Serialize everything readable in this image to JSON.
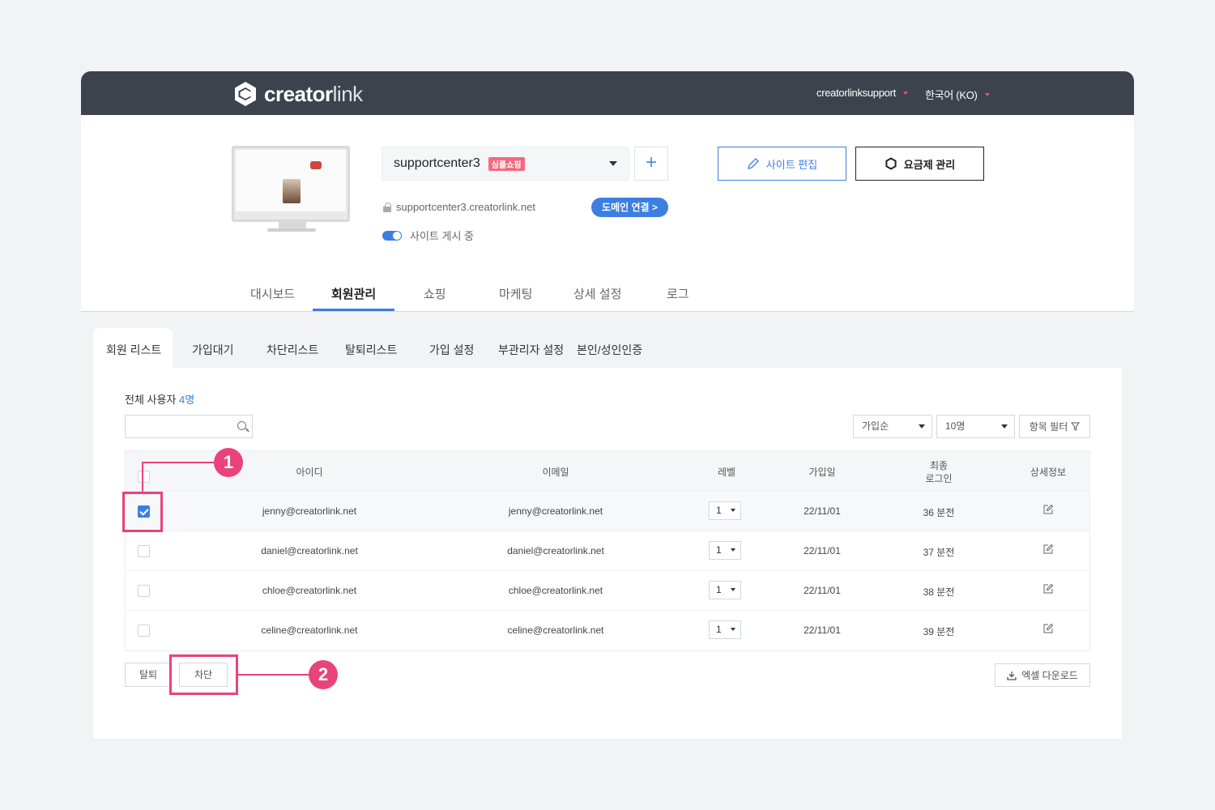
{
  "topbar": {
    "logo_bold": "creator",
    "logo_light": "link",
    "user": "creatorlinksupport",
    "language": "한국어 (KO)"
  },
  "site": {
    "name": "supportcenter3",
    "badge": "심플쇼핑",
    "add_label": "+",
    "url": "supportcenter3.creatorlink.net",
    "domain_button": "도메인 연결 >",
    "publish_status": "사이트 게시 중",
    "edit_button": "사이트 편집",
    "plan_button": "요금제 관리"
  },
  "main_tabs": [
    "대시보드",
    "회원관리",
    "쇼핑",
    "마케팅",
    "상세 설정",
    "로그"
  ],
  "sub_tabs": [
    "회원 리스트",
    "가입대기",
    "차단리스트",
    "탈퇴리스트",
    "가입 설정",
    "부관리자 설정",
    "본인/성인인증"
  ],
  "list": {
    "total_label": "전체 사용자",
    "total_count": "4명",
    "search_placeholder": "",
    "sort_select": "가입순",
    "page_size_select": "10명",
    "filter_button": "항목 필터"
  },
  "table": {
    "headers": {
      "id": "아이디",
      "email": "이메일",
      "level": "레벨",
      "joined": "가입일",
      "last_login_1": "최종",
      "last_login_2": "로그인",
      "detail": "상세정보"
    },
    "rows": [
      {
        "checked": true,
        "id": "jenny@creatorlink.net",
        "email": "jenny@creatorlink.net",
        "level": "1",
        "joined": "22/11/01",
        "last_login": "36 분전"
      },
      {
        "checked": false,
        "id": "daniel@creatorlink.net",
        "email": "daniel@creatorlink.net",
        "level": "1",
        "joined": "22/11/01",
        "last_login": "37 분전"
      },
      {
        "checked": false,
        "id": "chloe@creatorlink.net",
        "email": "chloe@creatorlink.net",
        "level": "1",
        "joined": "22/11/01",
        "last_login": "38 분전"
      },
      {
        "checked": false,
        "id": "celine@creatorlink.net",
        "email": "celine@creatorlink.net",
        "level": "1",
        "joined": "22/11/01",
        "last_login": "39 분전"
      }
    ]
  },
  "actions": {
    "withdraw": "탈퇴",
    "block": "차단",
    "excel": "엑셀 다운로드"
  },
  "annotations": {
    "step1": "1",
    "step2": "2",
    "color": "#e8437a"
  },
  "colors": {
    "accent": "#3c7fe0",
    "topbar": "#3d434d",
    "badge": "#f26b7d"
  }
}
